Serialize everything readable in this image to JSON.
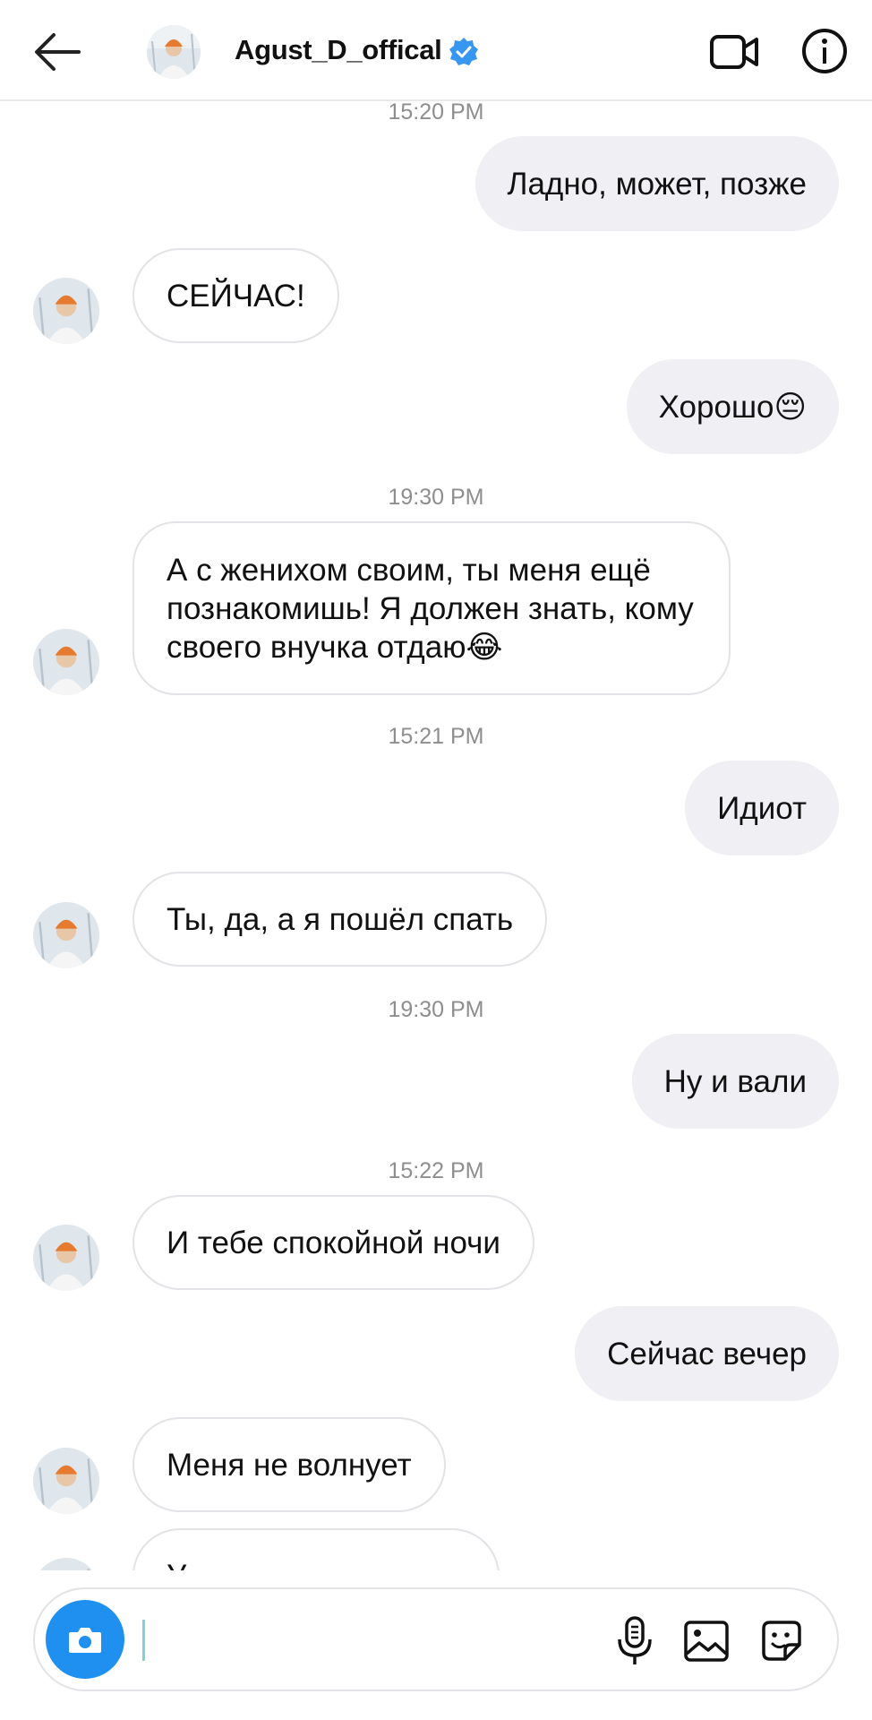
{
  "header": {
    "username": "Agust_D_offical",
    "verified": true
  },
  "messages": [
    {
      "type": "timestamp",
      "text": "15:20 PM"
    },
    {
      "type": "outgoing",
      "text": "Ладно, может, позже"
    },
    {
      "type": "incoming",
      "text": "СЕЙЧАС!"
    },
    {
      "type": "outgoing",
      "text": "Хорошо😔"
    },
    {
      "type": "timestamp",
      "text": "19:30 PM"
    },
    {
      "type": "incoming",
      "text": "А с женихом своим, ты меня ещё познакомишь! Я должен знать, кому своего внучка отдаю😂"
    },
    {
      "type": "timestamp",
      "text": "15:21 PM"
    },
    {
      "type": "outgoing",
      "text": "Идиот"
    },
    {
      "type": "incoming",
      "text": "Ты, да, а я пошёл спать"
    },
    {
      "type": "timestamp",
      "text": "19:30 PM"
    },
    {
      "type": "outgoing",
      "text": "Ну и вали"
    },
    {
      "type": "timestamp",
      "text": "15:22 PM"
    },
    {
      "type": "incoming",
      "text": "И тебе спокойной ночи"
    },
    {
      "type": "outgoing",
      "text": "Сейчас вечер"
    },
    {
      "type": "incoming",
      "text": "Меня не волнует"
    },
    {
      "type": "incoming",
      "text": "У"
    }
  ],
  "composer": {
    "value": "",
    "placeholder": ""
  },
  "icons": {
    "back": "arrow-left-icon",
    "verified": "verified-badge-icon",
    "video": "video-camera-icon",
    "info": "info-icon",
    "camera": "camera-icon",
    "mic": "microphone-icon",
    "gallery": "gallery-icon",
    "sticker": "sticker-icon"
  },
  "colors": {
    "accent": "#1f8ff0",
    "outgoing_bubble": "#efeff4",
    "timestamp": "#8e8e8e"
  }
}
